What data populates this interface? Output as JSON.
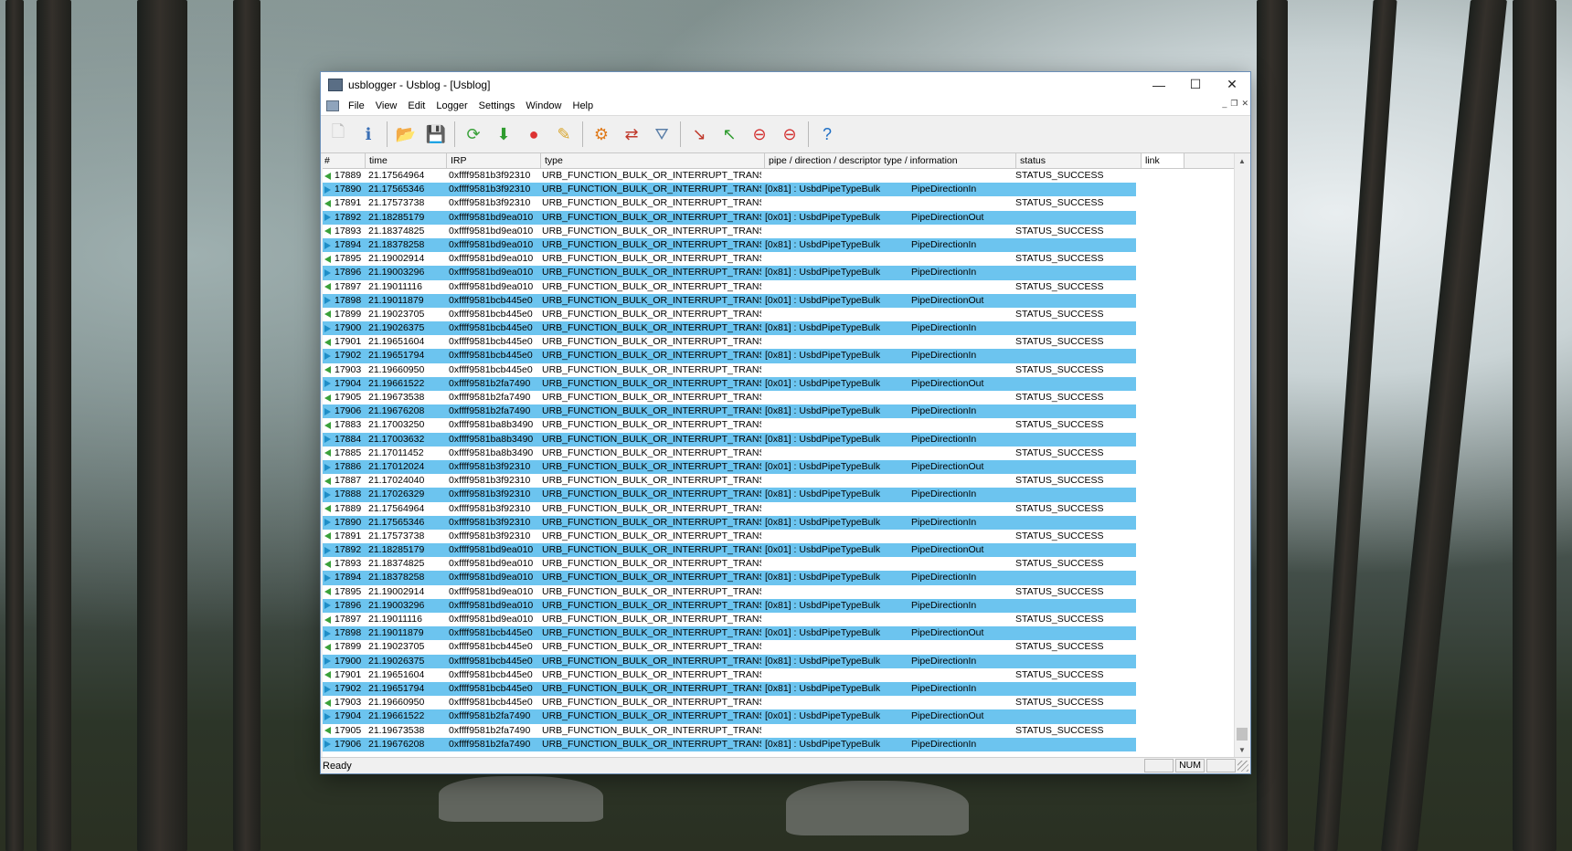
{
  "window": {
    "title": "usblogger - Usblog - [Usblog]",
    "controls": {
      "minimize": "—",
      "maximize": "☐",
      "close": "✕"
    },
    "mdi_controls": {
      "minimize": "_",
      "restore": "❐",
      "close": "✕"
    }
  },
  "menu": [
    "File",
    "View",
    "Edit",
    "Logger",
    "Settings",
    "Window",
    "Help"
  ],
  "toolbar": {
    "buttons": [
      {
        "name": "new-document-icon",
        "glyph": "🗋",
        "color": "#bfbfbf"
      },
      {
        "name": "info-icon",
        "glyph": "ℹ",
        "color": "#3a6fb5"
      },
      {
        "name": "open-folder-icon",
        "glyph": "📂",
        "color": "#d9a52b"
      },
      {
        "name": "save-icon",
        "glyph": "💾",
        "color": "#7a1f1f"
      },
      {
        "name": "refresh-icon",
        "glyph": "⟳",
        "color": "#3aa13a"
      },
      {
        "name": "download-icon",
        "glyph": "⬇",
        "color": "#2f9c2f"
      },
      {
        "name": "record-icon",
        "glyph": "●",
        "color": "#d33"
      },
      {
        "name": "edit-icon",
        "glyph": "✎",
        "color": "#d9a52b"
      },
      {
        "name": "device-settings-icon",
        "glyph": "⚙",
        "color": "#e07a1a"
      },
      {
        "name": "sync-icon",
        "glyph": "⇄",
        "color": "#c0392b"
      },
      {
        "name": "filter-icon",
        "glyph": "⛛",
        "color": "#5b7fa8"
      },
      {
        "name": "arrow-in-icon",
        "glyph": "↘",
        "color": "#c0392b"
      },
      {
        "name": "arrow-out-icon",
        "glyph": "↖",
        "color": "#2f9c2f"
      },
      {
        "name": "stop-in-icon",
        "glyph": "⊖",
        "color": "#d32f2f"
      },
      {
        "name": "stop-out-icon",
        "glyph": "⊖",
        "color": "#d32f2f"
      },
      {
        "name": "help-icon",
        "glyph": "?",
        "color": "#1f6fc5"
      }
    ]
  },
  "columns": [
    "#",
    "time",
    "IRP",
    "type",
    "pipe / direction / descriptor type / information",
    "status",
    "link"
  ],
  "rows": [
    {
      "num": "17889",
      "time": "21.17564964",
      "irp": "0xffff9581b3f92310",
      "type": "URB_FUNCTION_BULK_OR_INTERRUPT_TRANSFER",
      "pipe": "",
      "dir": "",
      "status": "STATUS_SUCCESS",
      "sel": false
    },
    {
      "num": "17890",
      "time": "21.17565346",
      "irp": "0xffff9581b3f92310",
      "type": "URB_FUNCTION_BULK_OR_INTERRUPT_TRANSFER",
      "pipe": "[0x81] : UsbdPipeTypeBulk",
      "dir": "PipeDirectionIn",
      "status": "",
      "sel": true
    },
    {
      "num": "17891",
      "time": "21.17573738",
      "irp": "0xffff9581b3f92310",
      "type": "URB_FUNCTION_BULK_OR_INTERRUPT_TRANSFER",
      "pipe": "",
      "dir": "",
      "status": "STATUS_SUCCESS",
      "sel": false
    },
    {
      "num": "17892",
      "time": "21.18285179",
      "irp": "0xffff9581bd9ea010",
      "type": "URB_FUNCTION_BULK_OR_INTERRUPT_TRANSFER",
      "pipe": "[0x01] : UsbdPipeTypeBulk",
      "dir": "PipeDirectionOut",
      "status": "",
      "sel": true
    },
    {
      "num": "17893",
      "time": "21.18374825",
      "irp": "0xffff9581bd9ea010",
      "type": "URB_FUNCTION_BULK_OR_INTERRUPT_TRANSFER",
      "pipe": "",
      "dir": "",
      "status": "STATUS_SUCCESS",
      "sel": false
    },
    {
      "num": "17894",
      "time": "21.18378258",
      "irp": "0xffff9581bd9ea010",
      "type": "URB_FUNCTION_BULK_OR_INTERRUPT_TRANSFER",
      "pipe": "[0x81] : UsbdPipeTypeBulk",
      "dir": "PipeDirectionIn",
      "status": "",
      "sel": true
    },
    {
      "num": "17895",
      "time": "21.19002914",
      "irp": "0xffff9581bd9ea010",
      "type": "URB_FUNCTION_BULK_OR_INTERRUPT_TRANSFER",
      "pipe": "",
      "dir": "",
      "status": "STATUS_SUCCESS",
      "sel": false
    },
    {
      "num": "17896",
      "time": "21.19003296",
      "irp": "0xffff9581bd9ea010",
      "type": "URB_FUNCTION_BULK_OR_INTERRUPT_TRANSFER",
      "pipe": "[0x81] : UsbdPipeTypeBulk",
      "dir": "PipeDirectionIn",
      "status": "",
      "sel": true
    },
    {
      "num": "17897",
      "time": "21.19011116",
      "irp": "0xffff9581bd9ea010",
      "type": "URB_FUNCTION_BULK_OR_INTERRUPT_TRANSFER",
      "pipe": "",
      "dir": "",
      "status": "STATUS_SUCCESS",
      "sel": false
    },
    {
      "num": "17898",
      "time": "21.19011879",
      "irp": "0xffff9581bcb445e0",
      "type": "URB_FUNCTION_BULK_OR_INTERRUPT_TRANSFER",
      "pipe": "[0x01] : UsbdPipeTypeBulk",
      "dir": "PipeDirectionOut",
      "status": "",
      "sel": true
    },
    {
      "num": "17899",
      "time": "21.19023705",
      "irp": "0xffff9581bcb445e0",
      "type": "URB_FUNCTION_BULK_OR_INTERRUPT_TRANSFER",
      "pipe": "",
      "dir": "",
      "status": "STATUS_SUCCESS",
      "sel": false
    },
    {
      "num": "17900",
      "time": "21.19026375",
      "irp": "0xffff9581bcb445e0",
      "type": "URB_FUNCTION_BULK_OR_INTERRUPT_TRANSFER",
      "pipe": "[0x81] : UsbdPipeTypeBulk",
      "dir": "PipeDirectionIn",
      "status": "",
      "sel": true
    },
    {
      "num": "17901",
      "time": "21.19651604",
      "irp": "0xffff9581bcb445e0",
      "type": "URB_FUNCTION_BULK_OR_INTERRUPT_TRANSFER",
      "pipe": "",
      "dir": "",
      "status": "STATUS_SUCCESS",
      "sel": false
    },
    {
      "num": "17902",
      "time": "21.19651794",
      "irp": "0xffff9581bcb445e0",
      "type": "URB_FUNCTION_BULK_OR_INTERRUPT_TRANSFER",
      "pipe": "[0x81] : UsbdPipeTypeBulk",
      "dir": "PipeDirectionIn",
      "status": "",
      "sel": true
    },
    {
      "num": "17903",
      "time": "21.19660950",
      "irp": "0xffff9581bcb445e0",
      "type": "URB_FUNCTION_BULK_OR_INTERRUPT_TRANSFER",
      "pipe": "",
      "dir": "",
      "status": "STATUS_SUCCESS",
      "sel": false
    },
    {
      "num": "17904",
      "time": "21.19661522",
      "irp": "0xffff9581b2fa7490",
      "type": "URB_FUNCTION_BULK_OR_INTERRUPT_TRANSFER",
      "pipe": "[0x01] : UsbdPipeTypeBulk",
      "dir": "PipeDirectionOut",
      "status": "",
      "sel": true
    },
    {
      "num": "17905",
      "time": "21.19673538",
      "irp": "0xffff9581b2fa7490",
      "type": "URB_FUNCTION_BULK_OR_INTERRUPT_TRANSFER",
      "pipe": "",
      "dir": "",
      "status": "STATUS_SUCCESS",
      "sel": false
    },
    {
      "num": "17906",
      "time": "21.19676208",
      "irp": "0xffff9581b2fa7490",
      "type": "URB_FUNCTION_BULK_OR_INTERRUPT_TRANSFER",
      "pipe": "[0x81] : UsbdPipeTypeBulk",
      "dir": "PipeDirectionIn",
      "status": "",
      "sel": true
    },
    {
      "num": "17883",
      "time": "21.17003250",
      "irp": "0xffff9581ba8b3490",
      "type": "URB_FUNCTION_BULK_OR_INTERRUPT_TRANSFER",
      "pipe": "",
      "dir": "",
      "status": "STATUS_SUCCESS",
      "sel": false
    },
    {
      "num": "17884",
      "time": "21.17003632",
      "irp": "0xffff9581ba8b3490",
      "type": "URB_FUNCTION_BULK_OR_INTERRUPT_TRANSFER",
      "pipe": "[0x81] : UsbdPipeTypeBulk",
      "dir": "PipeDirectionIn",
      "status": "",
      "sel": true
    },
    {
      "num": "17885",
      "time": "21.17011452",
      "irp": "0xffff9581ba8b3490",
      "type": "URB_FUNCTION_BULK_OR_INTERRUPT_TRANSFER",
      "pipe": "",
      "dir": "",
      "status": "STATUS_SUCCESS",
      "sel": false
    },
    {
      "num": "17886",
      "time": "21.17012024",
      "irp": "0xffff9581b3f92310",
      "type": "URB_FUNCTION_BULK_OR_INTERRUPT_TRANSFER",
      "pipe": "[0x01] : UsbdPipeTypeBulk",
      "dir": "PipeDirectionOut",
      "status": "",
      "sel": true
    },
    {
      "num": "17887",
      "time": "21.17024040",
      "irp": "0xffff9581b3f92310",
      "type": "URB_FUNCTION_BULK_OR_INTERRUPT_TRANSFER",
      "pipe": "",
      "dir": "",
      "status": "STATUS_SUCCESS",
      "sel": false
    },
    {
      "num": "17888",
      "time": "21.17026329",
      "irp": "0xffff9581b3f92310",
      "type": "URB_FUNCTION_BULK_OR_INTERRUPT_TRANSFER",
      "pipe": "[0x81] : UsbdPipeTypeBulk",
      "dir": "PipeDirectionIn",
      "status": "",
      "sel": true
    },
    {
      "num": "17889",
      "time": "21.17564964",
      "irp": "0xffff9581b3f92310",
      "type": "URB_FUNCTION_BULK_OR_INTERRUPT_TRANSFER",
      "pipe": "",
      "dir": "",
      "status": "STATUS_SUCCESS",
      "sel": false
    },
    {
      "num": "17890",
      "time": "21.17565346",
      "irp": "0xffff9581b3f92310",
      "type": "URB_FUNCTION_BULK_OR_INTERRUPT_TRANSFER",
      "pipe": "[0x81] : UsbdPipeTypeBulk",
      "dir": "PipeDirectionIn",
      "status": "",
      "sel": true
    },
    {
      "num": "17891",
      "time": "21.17573738",
      "irp": "0xffff9581b3f92310",
      "type": "URB_FUNCTION_BULK_OR_INTERRUPT_TRANSFER",
      "pipe": "",
      "dir": "",
      "status": "STATUS_SUCCESS",
      "sel": false
    },
    {
      "num": "17892",
      "time": "21.18285179",
      "irp": "0xffff9581bd9ea010",
      "type": "URB_FUNCTION_BULK_OR_INTERRUPT_TRANSFER",
      "pipe": "[0x01] : UsbdPipeTypeBulk",
      "dir": "PipeDirectionOut",
      "status": "",
      "sel": true
    },
    {
      "num": "17893",
      "time": "21.18374825",
      "irp": "0xffff9581bd9ea010",
      "type": "URB_FUNCTION_BULK_OR_INTERRUPT_TRANSFER",
      "pipe": "",
      "dir": "",
      "status": "STATUS_SUCCESS",
      "sel": false
    },
    {
      "num": "17894",
      "time": "21.18378258",
      "irp": "0xffff9581bd9ea010",
      "type": "URB_FUNCTION_BULK_OR_INTERRUPT_TRANSFER",
      "pipe": "[0x81] : UsbdPipeTypeBulk",
      "dir": "PipeDirectionIn",
      "status": "",
      "sel": true
    },
    {
      "num": "17895",
      "time": "21.19002914",
      "irp": "0xffff9581bd9ea010",
      "type": "URB_FUNCTION_BULK_OR_INTERRUPT_TRANSFER",
      "pipe": "",
      "dir": "",
      "status": "STATUS_SUCCESS",
      "sel": false
    },
    {
      "num": "17896",
      "time": "21.19003296",
      "irp": "0xffff9581bd9ea010",
      "type": "URB_FUNCTION_BULK_OR_INTERRUPT_TRANSFER",
      "pipe": "[0x81] : UsbdPipeTypeBulk",
      "dir": "PipeDirectionIn",
      "status": "",
      "sel": true
    },
    {
      "num": "17897",
      "time": "21.19011116",
      "irp": "0xffff9581bd9ea010",
      "type": "URB_FUNCTION_BULK_OR_INTERRUPT_TRANSFER",
      "pipe": "",
      "dir": "",
      "status": "STATUS_SUCCESS",
      "sel": false
    },
    {
      "num": "17898",
      "time": "21.19011879",
      "irp": "0xffff9581bcb445e0",
      "type": "URB_FUNCTION_BULK_OR_INTERRUPT_TRANSFER",
      "pipe": "[0x01] : UsbdPipeTypeBulk",
      "dir": "PipeDirectionOut",
      "status": "",
      "sel": true
    },
    {
      "num": "17899",
      "time": "21.19023705",
      "irp": "0xffff9581bcb445e0",
      "type": "URB_FUNCTION_BULK_OR_INTERRUPT_TRANSFER",
      "pipe": "",
      "dir": "",
      "status": "STATUS_SUCCESS",
      "sel": false
    },
    {
      "num": "17900",
      "time": "21.19026375",
      "irp": "0xffff9581bcb445e0",
      "type": "URB_FUNCTION_BULK_OR_INTERRUPT_TRANSFER",
      "pipe": "[0x81] : UsbdPipeTypeBulk",
      "dir": "PipeDirectionIn",
      "status": "",
      "sel": true
    },
    {
      "num": "17901",
      "time": "21.19651604",
      "irp": "0xffff9581bcb445e0",
      "type": "URB_FUNCTION_BULK_OR_INTERRUPT_TRANSFER",
      "pipe": "",
      "dir": "",
      "status": "STATUS_SUCCESS",
      "sel": false
    },
    {
      "num": "17902",
      "time": "21.19651794",
      "irp": "0xffff9581bcb445e0",
      "type": "URB_FUNCTION_BULK_OR_INTERRUPT_TRANSFER",
      "pipe": "[0x81] : UsbdPipeTypeBulk",
      "dir": "PipeDirectionIn",
      "status": "",
      "sel": true
    },
    {
      "num": "17903",
      "time": "21.19660950",
      "irp": "0xffff9581bcb445e0",
      "type": "URB_FUNCTION_BULK_OR_INTERRUPT_TRANSFER",
      "pipe": "",
      "dir": "",
      "status": "STATUS_SUCCESS",
      "sel": false
    },
    {
      "num": "17904",
      "time": "21.19661522",
      "irp": "0xffff9581b2fa7490",
      "type": "URB_FUNCTION_BULK_OR_INTERRUPT_TRANSFER",
      "pipe": "[0x01] : UsbdPipeTypeBulk",
      "dir": "PipeDirectionOut",
      "status": "",
      "sel": true
    },
    {
      "num": "17905",
      "time": "21.19673538",
      "irp": "0xffff9581b2fa7490",
      "type": "URB_FUNCTION_BULK_OR_INTERRUPT_TRANSFER",
      "pipe": "",
      "dir": "",
      "status": "STATUS_SUCCESS",
      "sel": false
    },
    {
      "num": "17906",
      "time": "21.19676208",
      "irp": "0xffff9581b2fa7490",
      "type": "URB_FUNCTION_BULK_OR_INTERRUPT_TRANSFER",
      "pipe": "[0x81] : UsbdPipeTypeBulk",
      "dir": "PipeDirectionIn",
      "status": "",
      "sel": true
    }
  ],
  "statusbar": {
    "text": "Ready",
    "num": "NUM"
  },
  "scrollbar": {
    "up": "▲",
    "down": "▼"
  },
  "colors": {
    "selection": "#6cc4ef",
    "out_arrow": "#3aa13a",
    "in_arrow": "#1f8ec8"
  }
}
